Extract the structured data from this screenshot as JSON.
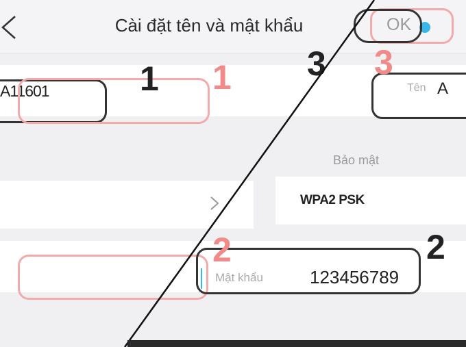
{
  "header": {
    "title": "Cài đặt tên và mật khẩu",
    "ok_label": "OK"
  },
  "name_field": {
    "value": "A11601",
    "label_right": "Tên",
    "value_right": "A"
  },
  "security_field": {
    "label": "Bảo mật",
    "value": "WPA2 PSK"
  },
  "password_field": {
    "label": "Mật khẩu",
    "value": "123456789"
  },
  "annotations": {
    "step1": "1",
    "step2": "2",
    "step3": "3"
  },
  "colors": {
    "annotation_red": "#f2aaaa",
    "annotation_dark": "#333333",
    "accent_blue": "#38b8e8"
  }
}
